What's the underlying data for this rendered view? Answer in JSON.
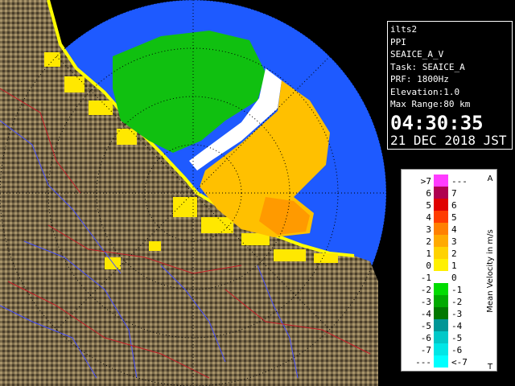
{
  "info": {
    "station": "ilts2",
    "product": "PPI",
    "scan": "SEAICE_A_V",
    "task": "Task: SEAICE_A",
    "prf": "PRF: 1800Hz",
    "elevation": "Elevation:1.0",
    "max_range": "Max Range:80 km",
    "time": "04:30:35",
    "date": "21 DEC 2018 JST"
  },
  "legend": {
    "title": "Mean Velocity in m/s",
    "top_marker": "A",
    "bottom_marker": "T",
    "rows": [
      {
        "left": ">7",
        "right": "---",
        "color": "#ff3cff"
      },
      {
        "left": "6",
        "right": "7",
        "color": "#b00050"
      },
      {
        "left": "5",
        "right": "6",
        "color": "#e00000"
      },
      {
        "left": "4",
        "right": "5",
        "color": "#ff3c00"
      },
      {
        "left": "3",
        "right": "4",
        "color": "#ff8000"
      },
      {
        "left": "2",
        "right": "3",
        "color": "#ffaa00"
      },
      {
        "left": "1",
        "right": "2",
        "color": "#ffd200"
      },
      {
        "left": "0",
        "right": "1",
        "color": "#fff000"
      },
      {
        "left": "-1",
        "right": "0",
        "color": "#ffffff"
      },
      {
        "left": "-2",
        "right": "-1",
        "color": "#00dc00"
      },
      {
        "left": "-3",
        "right": "-2",
        "color": "#00aa00"
      },
      {
        "left": "-4",
        "right": "-3",
        "color": "#007800"
      },
      {
        "left": "-5",
        "right": "-4",
        "color": "#009696"
      },
      {
        "left": "-6",
        "right": "-5",
        "color": "#00c8c8"
      },
      {
        "left": "-7",
        "right": "-6",
        "color": "#00e6e6"
      },
      {
        "left": "---",
        "right": "<-7",
        "color": "#00ffff"
      }
    ]
  },
  "colors": {
    "background": "#000000",
    "sea": "#1e5aff",
    "land": "#7a6a4a",
    "river": "#4650ff",
    "boundary": "#c81e28",
    "coast": "#ffff00"
  }
}
